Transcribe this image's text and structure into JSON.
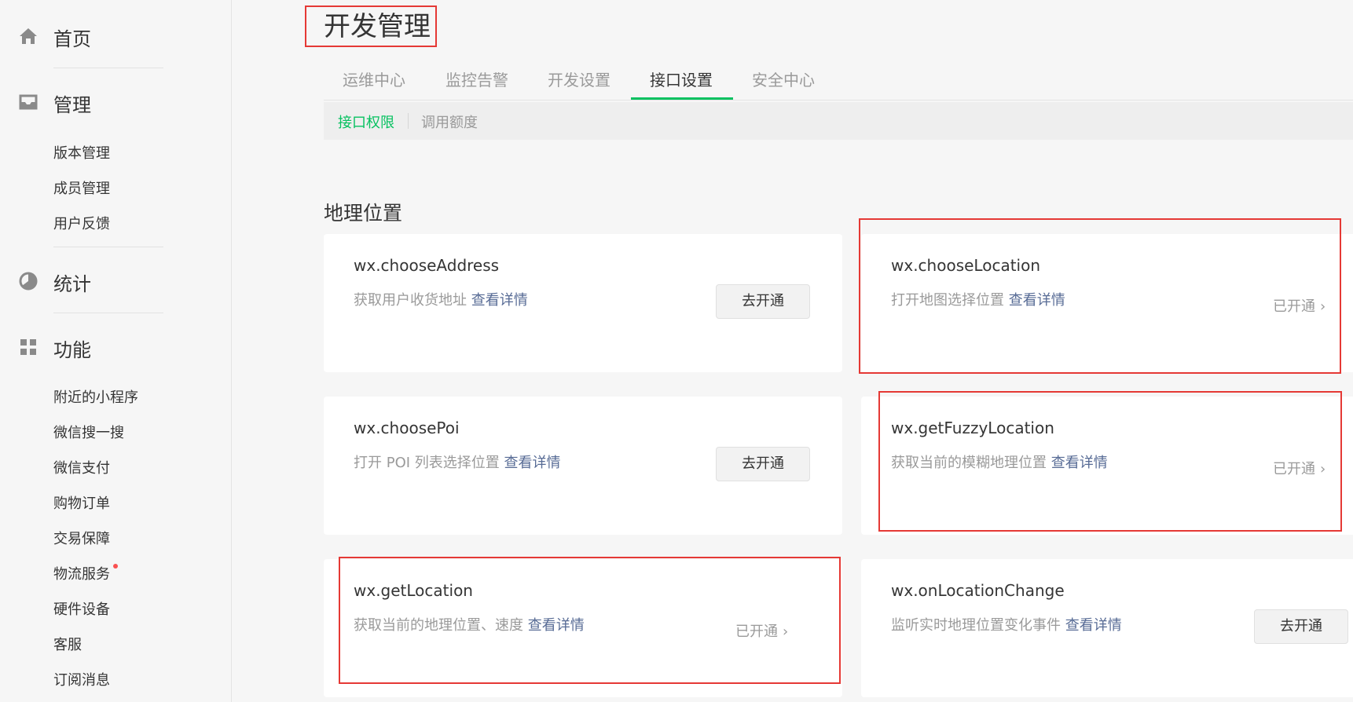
{
  "sidebar": {
    "groups": [
      {
        "label": "首页",
        "icon": "home-icon"
      },
      {
        "label": "管理",
        "icon": "inbox-icon"
      },
      {
        "label": "统计",
        "icon": "pie-chart-icon"
      },
      {
        "label": "功能",
        "icon": "grid-icon"
      }
    ],
    "manage_items": [
      "版本管理",
      "成员管理",
      "用户反馈"
    ],
    "feature_items": [
      "附近的小程序",
      "微信搜一搜",
      "微信支付",
      "购物订单",
      "交易保障",
      "物流服务",
      "硬件设备",
      "客服",
      "订阅消息"
    ]
  },
  "header": {
    "title": "开发管理",
    "tabs": [
      "运维中心",
      "监控告警",
      "开发设置",
      "接口设置",
      "安全中心"
    ],
    "active_tab": "接口设置",
    "subtabs": [
      "接口权限",
      "调用额度"
    ],
    "active_subtab": "接口权限"
  },
  "section": {
    "title": "地理位置"
  },
  "cards": [
    {
      "name": "wx.chooseAddress",
      "desc": "获取用户收货地址",
      "link": "查看详情",
      "action": "去开通"
    },
    {
      "name": "wx.chooseLocation",
      "desc": "打开地图选择位置",
      "link": "查看详情",
      "status": "已开通"
    },
    {
      "name": "wx.choosePoi",
      "desc": "打开 POI 列表选择位置",
      "link": "查看详情",
      "action": "去开通"
    },
    {
      "name": "wx.getFuzzyLocation",
      "desc": "获取当前的模糊地理位置",
      "link": "查看详情",
      "status": "已开通"
    },
    {
      "name": "wx.getLocation",
      "desc": "获取当前的地理位置、速度",
      "link": "查看详情",
      "status": "已开通"
    },
    {
      "name": "wx.onLocationChange",
      "desc": "监听实时地理位置变化事件",
      "link": "查看详情",
      "action": "去开通"
    }
  ],
  "colors": {
    "accent": "#07c160",
    "link": "#576b95",
    "highlight": "#e53935",
    "badge": "#fa5151"
  }
}
